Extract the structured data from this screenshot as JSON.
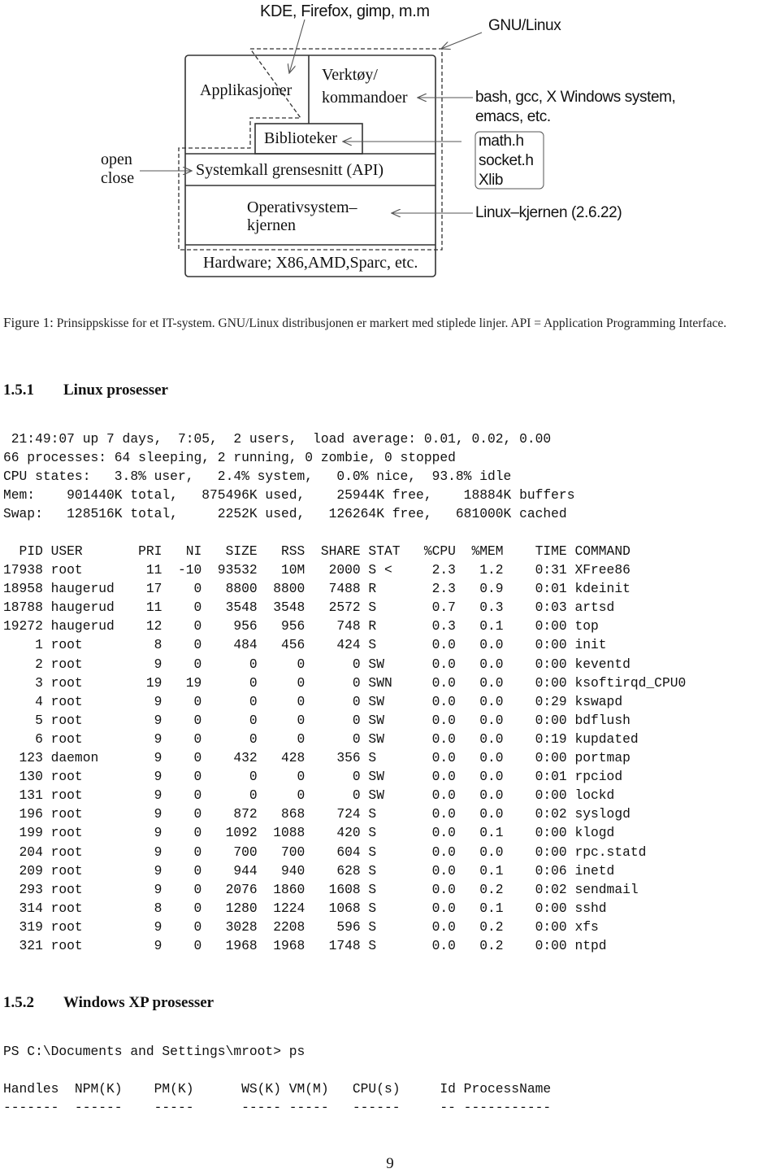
{
  "figure": {
    "labels": {
      "top_apps": "KDE, Firefox, gimp,  m.m",
      "gnu_linux": "GNU/Linux",
      "applikasjoner": "Applikasjoner",
      "verktoy_line1": "Verktøy/",
      "verktoy_line2": "kommandoer",
      "biblioteker": "Biblioteker",
      "systemkall": "Systemkall grensesnitt (API)",
      "os_line1": "Operativsystem–",
      "os_line2": "kjernen",
      "hardware": "Hardware; X86,AMD,Sparc, etc.",
      "open": "open",
      "close": "close",
      "tools_line1": "bash, gcc, X Windows system,",
      "tools_line2": "emacs, etc.",
      "lib_files": [
        "math.h",
        "socket.h",
        "Xlib"
      ],
      "kernel_version": "Linux–kjernen (2.6.22)"
    },
    "caption_prefix": "Figure 1:",
    "caption_text": "Prinsippskisse for et IT-system. GNU/Linux distribusjonen er markert med stiplede linjer. API = Application Programming Interface."
  },
  "section_linux": {
    "number": "1.5.1",
    "title": "Linux prosesser",
    "top_summary": [
      " 21:49:07 up 7 days,  7:05,  2 users,  load average: 0.01, 0.02, 0.00",
      "66 processes: 64 sleeping, 2 running, 0 zombie, 0 stopped",
      "CPU states:   3.8% user,   2.4% system,   0.0% nice,  93.8% idle",
      "Mem:    901440K total,   875496K used,    25944K free,    18884K buffers",
      "Swap:   128516K total,     2252K used,   126264K free,   681000K cached"
    ],
    "table": {
      "columns": [
        "PID",
        "USER",
        "PRI",
        "NI",
        "SIZE",
        "RSS",
        "SHARE",
        "STAT",
        "%CPU",
        "%MEM",
        "TIME",
        "COMMAND"
      ],
      "rows": [
        [
          "17938",
          "root",
          "11",
          "-10",
          "93532",
          "10M",
          "2000",
          "S <",
          "2.3",
          "1.2",
          "0:31",
          "XFree86"
        ],
        [
          "18958",
          "haugerud",
          "17",
          "0",
          "8800",
          "8800",
          "7488",
          "R",
          "2.3",
          "0.9",
          "0:01",
          "kdeinit"
        ],
        [
          "18788",
          "haugerud",
          "11",
          "0",
          "3548",
          "3548",
          "2572",
          "S",
          "0.7",
          "0.3",
          "0:03",
          "artsd"
        ],
        [
          "19272",
          "haugerud",
          "12",
          "0",
          "956",
          "956",
          "748",
          "R",
          "0.3",
          "0.1",
          "0:00",
          "top"
        ],
        [
          "1",
          "root",
          "8",
          "0",
          "484",
          "456",
          "424",
          "S",
          "0.0",
          "0.0",
          "0:00",
          "init"
        ],
        [
          "2",
          "root",
          "9",
          "0",
          "0",
          "0",
          "0",
          "SW",
          "0.0",
          "0.0",
          "0:00",
          "keventd"
        ],
        [
          "3",
          "root",
          "19",
          "19",
          "0",
          "0",
          "0",
          "SWN",
          "0.0",
          "0.0",
          "0:00",
          "ksoftirqd_CPU0"
        ],
        [
          "4",
          "root",
          "9",
          "0",
          "0",
          "0",
          "0",
          "SW",
          "0.0",
          "0.0",
          "0:29",
          "kswapd"
        ],
        [
          "5",
          "root",
          "9",
          "0",
          "0",
          "0",
          "0",
          "SW",
          "0.0",
          "0.0",
          "0:00",
          "bdflush"
        ],
        [
          "6",
          "root",
          "9",
          "0",
          "0",
          "0",
          "0",
          "SW",
          "0.0",
          "0.0",
          "0:19",
          "kupdated"
        ],
        [
          "123",
          "daemon",
          "9",
          "0",
          "432",
          "428",
          "356",
          "S",
          "0.0",
          "0.0",
          "0:00",
          "portmap"
        ],
        [
          "130",
          "root",
          "9",
          "0",
          "0",
          "0",
          "0",
          "SW",
          "0.0",
          "0.0",
          "0:01",
          "rpciod"
        ],
        [
          "131",
          "root",
          "9",
          "0",
          "0",
          "0",
          "0",
          "SW",
          "0.0",
          "0.0",
          "0:00",
          "lockd"
        ],
        [
          "196",
          "root",
          "9",
          "0",
          "872",
          "868",
          "724",
          "S",
          "0.0",
          "0.0",
          "0:02",
          "syslogd"
        ],
        [
          "199",
          "root",
          "9",
          "0",
          "1092",
          "1088",
          "420",
          "S",
          "0.0",
          "0.1",
          "0:00",
          "klogd"
        ],
        [
          "204",
          "root",
          "9",
          "0",
          "700",
          "700",
          "604",
          "S",
          "0.0",
          "0.0",
          "0:00",
          "rpc.statd"
        ],
        [
          "209",
          "root",
          "9",
          "0",
          "944",
          "940",
          "628",
          "S",
          "0.0",
          "0.1",
          "0:06",
          "inetd"
        ],
        [
          "293",
          "root",
          "9",
          "0",
          "2076",
          "1860",
          "1608",
          "S",
          "0.0",
          "0.2",
          "0:02",
          "sendmail"
        ],
        [
          "314",
          "root",
          "8",
          "0",
          "1280",
          "1224",
          "1068",
          "S",
          "0.0",
          "0.1",
          "0:00",
          "sshd"
        ],
        [
          "319",
          "root",
          "9",
          "0",
          "3028",
          "2208",
          "596",
          "S",
          "0.0",
          "0.2",
          "0:00",
          "xfs"
        ],
        [
          "321",
          "root",
          "9",
          "0",
          "1968",
          "1968",
          "1748",
          "S",
          "0.0",
          "0.2",
          "0:00",
          "ntpd"
        ]
      ]
    }
  },
  "section_windows": {
    "number": "1.5.2",
    "title": "Windows XP prosesser",
    "prompt_line": "PS C:\\Documents and Settings\\mroot> ps",
    "header_line": "Handles  NPM(K)    PM(K)      WS(K) VM(M)   CPU(s)     Id ProcessName",
    "separator_line": "-------  ------    -----      ----- -----   ------     -- -----------"
  },
  "page_number": "9"
}
